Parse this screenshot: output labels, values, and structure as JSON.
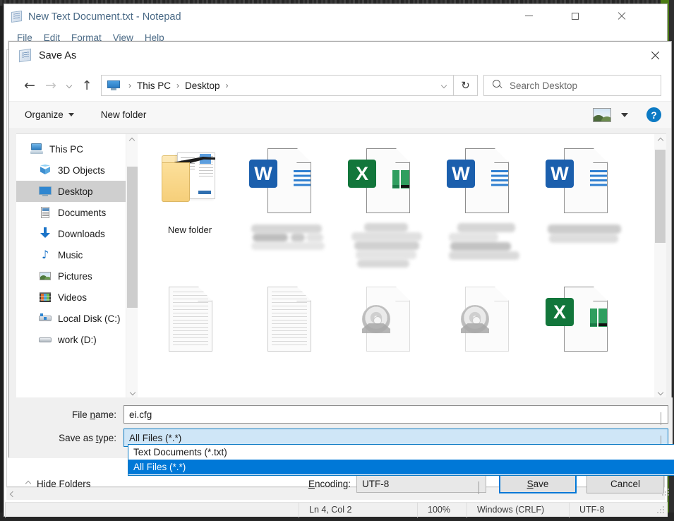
{
  "notepad": {
    "title": "New Text Document.txt - Notepad",
    "menus": [
      "File",
      "Edit",
      "Format",
      "View",
      "Help"
    ],
    "window_buttons": {
      "minimize": "minimize-icon",
      "maximize": "maximize-icon",
      "close": "close-icon"
    },
    "statusbar": {
      "cursor": "Ln 4, Col 2",
      "zoom": "100%",
      "line_ending": "Windows (CRLF)",
      "encoding": "UTF-8"
    }
  },
  "dialog": {
    "title": "Save As",
    "icon": "notepad-icon",
    "close_label": "close-icon",
    "nav": {
      "back": "←",
      "forward": "→",
      "recent": "recent-locations-icon",
      "up": "↑"
    },
    "address": {
      "icon": "this-pc-icon",
      "crumbs": [
        "This PC",
        "Desktop"
      ],
      "separator": "›"
    },
    "refresh": "↻",
    "search": {
      "icon": "search-icon",
      "placeholder": "Search Desktop"
    },
    "commands": {
      "organize": "Organize",
      "new_folder": "New folder",
      "view_icon": "view-layout-icon",
      "help": "?"
    },
    "navpane": [
      {
        "label": "This PC",
        "icon": "this-pc-icon",
        "depth": 0,
        "selected": false
      },
      {
        "label": "3D Objects",
        "icon": "3d-objects-icon",
        "depth": 1,
        "selected": false
      },
      {
        "label": "Desktop",
        "icon": "desktop-icon",
        "depth": 1,
        "selected": true
      },
      {
        "label": "Documents",
        "icon": "documents-icon",
        "depth": 1,
        "selected": false
      },
      {
        "label": "Downloads",
        "icon": "downloads-icon",
        "depth": 1,
        "selected": false
      },
      {
        "label": "Music",
        "icon": "music-icon",
        "depth": 1,
        "selected": false
      },
      {
        "label": "Pictures",
        "icon": "pictures-icon",
        "depth": 1,
        "selected": false
      },
      {
        "label": "Videos",
        "icon": "videos-icon",
        "depth": 1,
        "selected": false
      },
      {
        "label": "Local Disk (C:)",
        "icon": "drive-icon",
        "depth": 1,
        "selected": false
      },
      {
        "label": "work (D:)",
        "icon": "drive-icon",
        "depth": 1,
        "selected": false
      }
    ],
    "files": [
      {
        "kind": "folder",
        "label": "New folder",
        "redacted": false
      },
      {
        "kind": "word",
        "label": "",
        "redacted": true
      },
      {
        "kind": "excel",
        "label": "",
        "redacted": true
      },
      {
        "kind": "word",
        "label": "",
        "redacted": true
      },
      {
        "kind": "word",
        "label": "",
        "redacted": true
      },
      {
        "kind": "text",
        "label": "",
        "redacted": false
      },
      {
        "kind": "text",
        "label": "",
        "redacted": false
      },
      {
        "kind": "disc",
        "label": "",
        "redacted": false
      },
      {
        "kind": "disc",
        "label": "",
        "redacted": false
      },
      {
        "kind": "excel",
        "label": "",
        "redacted": false
      }
    ],
    "form": {
      "file_name_label": "File name:",
      "file_name_value": "ei.cfg",
      "save_as_type_label": "Save as type:",
      "save_as_type_value": "All Files  (*.*)",
      "type_options": [
        "Text Documents (*.txt)",
        "All Files  (*.*)"
      ],
      "type_selected_index": 1
    },
    "footer": {
      "hide_folders": "Hide Folders",
      "encoding_label": "Encoding:",
      "encoding_value": "UTF-8",
      "save": "Save",
      "cancel": "Cancel"
    }
  },
  "colors": {
    "accent": "#0078d7",
    "selected_row": "#cfcfcf",
    "combo_highlight": "#cfe6f7",
    "word_blue": "#1b5fad",
    "excel_green": "#12763b",
    "desktop_green": "#4a7a12"
  }
}
